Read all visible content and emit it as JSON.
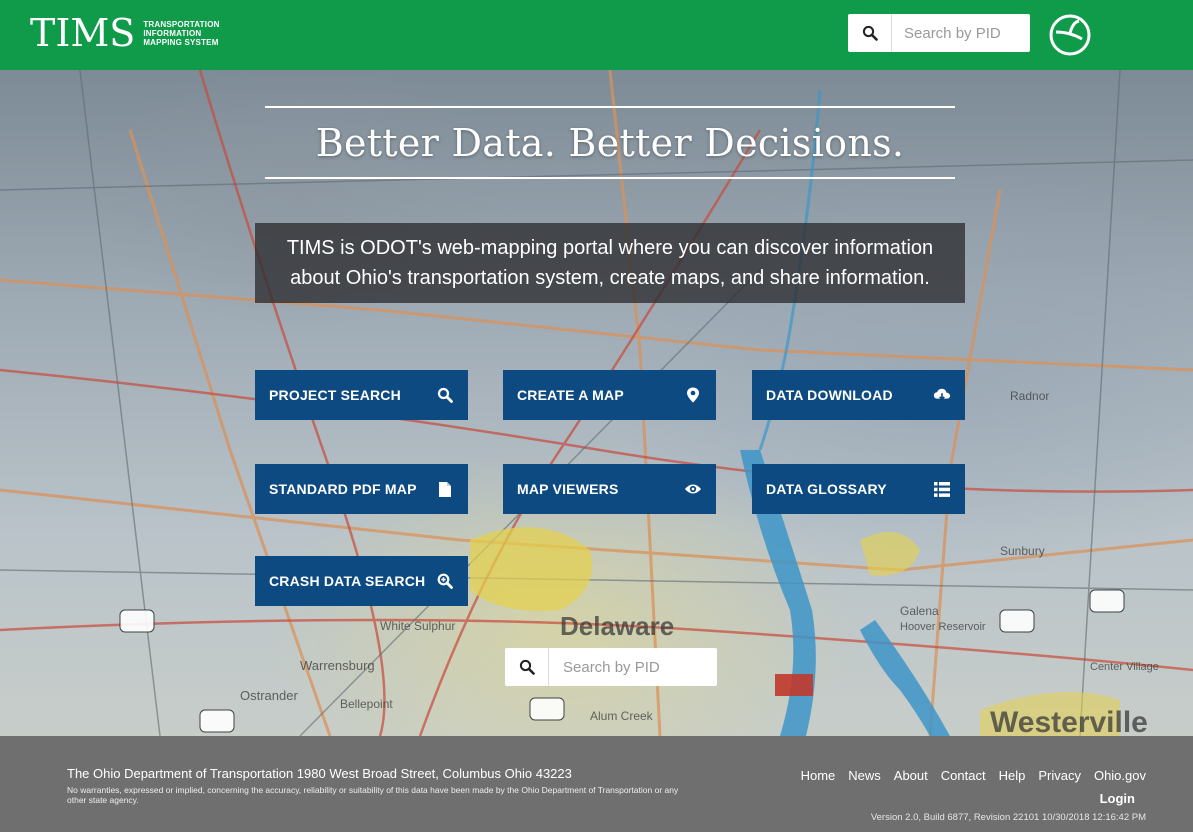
{
  "header": {
    "logo_word": "TIMS",
    "logo_sub_lines": [
      "TRANSPORTATION",
      "INFORMATION",
      "MAPPING SYSTEM"
    ],
    "search_placeholder": "Search by PID",
    "search_icon": "search-icon",
    "agency_icon": "odot-logo-icon"
  },
  "hero": {
    "tagline": "Better Data. Better Decisions.",
    "intro_line1": "TIMS is ODOT's web-mapping portal where you can discover information",
    "intro_line2": "about Ohio's transportation system, create maps, and share information."
  },
  "tiles": [
    {
      "label": "PROJECT SEARCH",
      "icon": "search-icon"
    },
    {
      "label": "CREATE A MAP",
      "icon": "map-marker-icon"
    },
    {
      "label": "DATA DOWNLOAD",
      "icon": "cloud-download-icon"
    },
    {
      "label": "STANDARD PDF MAP",
      "icon": "file-icon"
    },
    {
      "label": "MAP VIEWERS",
      "icon": "eye-icon"
    },
    {
      "label": "DATA GLOSSARY",
      "icon": "list-icon"
    },
    {
      "label": "CRASH DATA SEARCH",
      "icon": "search-plus-icon"
    }
  ],
  "bottom_search": {
    "placeholder": "Search by PID",
    "icon": "search-icon"
  },
  "footer": {
    "address": "The Ohio Department of Transportation 1980 West Broad Street, Columbus Ohio 43223",
    "disclaimer": "No warranties, expressed or implied, concerning the accuracy, reliability or suitability of this data have been made by the Ohio Department of Transportation or any other state agency.",
    "links": [
      "Home",
      "News",
      "About",
      "Contact",
      "Help",
      "Privacy",
      "Ohio.gov"
    ],
    "login": "Login",
    "version": "Version 2.0, Build 6877, Revision 22101 10/30/2018 12:16:42 PM"
  },
  "colors": {
    "header_green": "#0f9b4a",
    "tile_blue": "#0e4a82",
    "footer_gray": "#6f6f6f"
  },
  "map_labels": [
    "Delaware",
    "Warrensburg",
    "White Sulphur",
    "Ostrander",
    "Bellepoint",
    "Alum Creek",
    "Galena",
    "Hoover Reservoir",
    "Center Village",
    "Sunbury",
    "Westerville",
    "Radnor"
  ]
}
